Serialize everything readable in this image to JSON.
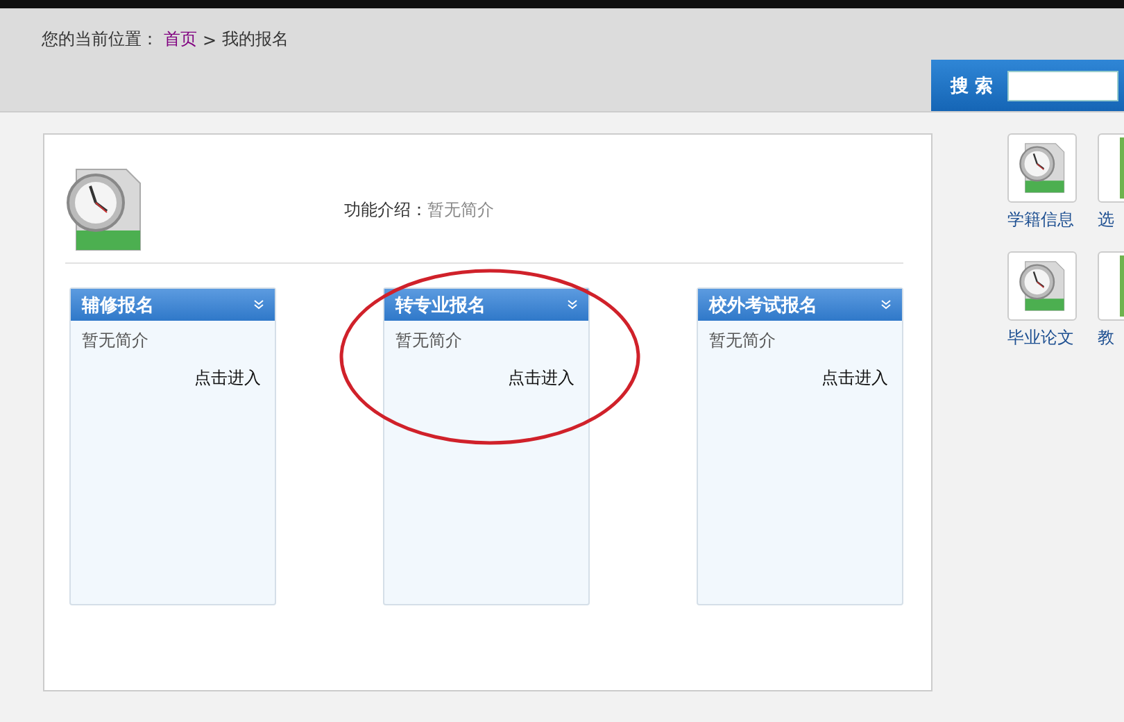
{
  "breadcrumb": {
    "label": "您的当前位置：",
    "home": "首页",
    "separator": ">",
    "current": "我的报名"
  },
  "search": {
    "button": "搜 索"
  },
  "intro": {
    "label": "功能介绍：",
    "value": "暂无简介"
  },
  "cards": [
    {
      "title": "辅修报名",
      "description": "暂无简介",
      "link": "点击进入"
    },
    {
      "title": "转专业报名",
      "description": "暂无简介",
      "link": "点击进入"
    },
    {
      "title": "校外考试报名",
      "description": "暂无简介",
      "link": "点击进入"
    }
  ],
  "shortcuts": [
    {
      "label": "学籍信息",
      "kind": "clock"
    },
    {
      "label": "选",
      "kind": "green"
    },
    {
      "label": "毕业论文",
      "kind": "clock"
    },
    {
      "label": "教",
      "kind": "green"
    }
  ]
}
